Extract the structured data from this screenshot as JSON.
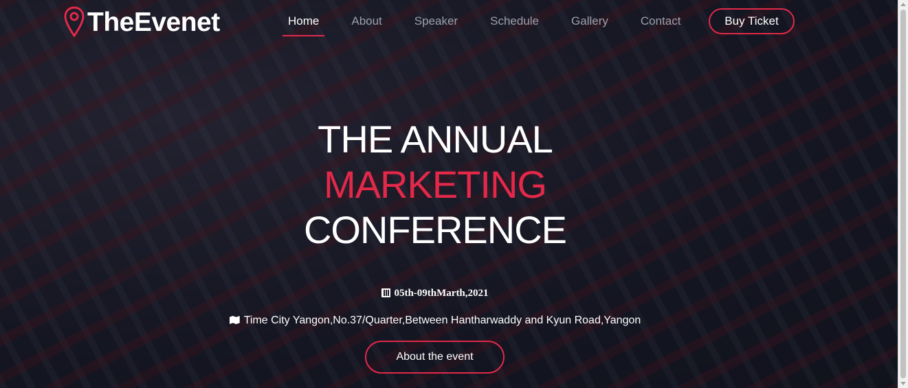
{
  "brand": {
    "name": "TheEvenet",
    "accent": "#e4284a"
  },
  "nav": {
    "items": [
      {
        "label": "Home",
        "active": true
      },
      {
        "label": "About",
        "active": false
      },
      {
        "label": "Speaker",
        "active": false
      },
      {
        "label": "Schedule",
        "active": false
      },
      {
        "label": "Gallery",
        "active": false
      },
      {
        "label": "Contact",
        "active": false
      }
    ],
    "cta_label": "Buy Ticket"
  },
  "hero": {
    "title_line1": "THE ANNUAL",
    "title_line2": "MARKETING",
    "title_line3": "CONFERENCE",
    "date": "05th-09thMarth,2021",
    "date_icon": "calendar-icon",
    "location": "Time City Yangon,No.37/Quarter,Between Hantharwaddy and Kyun Road,Yangon",
    "location_icon": "map-icon",
    "button_label": "About the event"
  }
}
